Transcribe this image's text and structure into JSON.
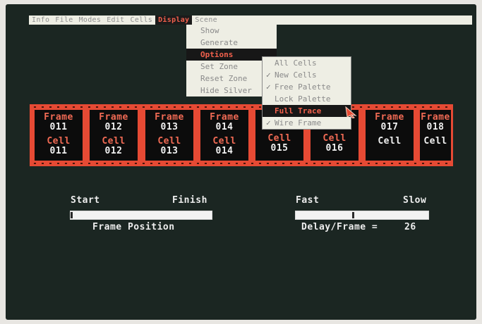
{
  "menubar": {
    "items": [
      "Info",
      "File",
      "Modes",
      "Edit",
      "Cells",
      "Display",
      "Scene"
    ],
    "active": "Display"
  },
  "display_menu": {
    "items": [
      "Show",
      "Generate",
      "Options",
      "Set Zone",
      "Reset Zone",
      "Hide Silver"
    ],
    "selected": "Options"
  },
  "options_menu": {
    "items": [
      {
        "label": "All Cells",
        "checked": false
      },
      {
        "label": "New Cells",
        "checked": true
      },
      {
        "label": "Free Palette",
        "checked": true
      },
      {
        "label": "Lock Palette",
        "checked": false
      },
      {
        "label": "Full Trace",
        "checked": false,
        "selected": true
      },
      {
        "label": "Wire Frame",
        "checked": true
      }
    ]
  },
  "filmstrip": {
    "frames": [
      {
        "frame_label": "Frame",
        "frame_num": "011",
        "cell_label": "Cell",
        "cell_num": "011"
      },
      {
        "frame_label": "Frame",
        "frame_num": "012",
        "cell_label": "Cell",
        "cell_num": "012"
      },
      {
        "frame_label": "Frame",
        "frame_num": "013",
        "cell_label": "Cell",
        "cell_num": "013"
      },
      {
        "frame_label": "Frame",
        "frame_num": "014",
        "cell_label": "Cell",
        "cell_num": "014"
      },
      {
        "frame_label": "",
        "frame_num": "",
        "cell_label": "Cell",
        "cell_num": "015"
      },
      {
        "frame_label": "",
        "frame_num": "",
        "cell_label": "Cell",
        "cell_num": "016"
      },
      {
        "frame_label": "Frame",
        "frame_num": "017",
        "cell_label": "Cell",
        "cell_num": ""
      },
      {
        "frame_label": "Frame",
        "frame_num": "018",
        "cell_label": "Cell",
        "cell_num": ""
      }
    ]
  },
  "frame_position": {
    "start_label": "Start",
    "finish_label": "Finish",
    "caption": "Frame Position",
    "value": 0.0
  },
  "speed": {
    "fast_label": "Fast",
    "slow_label": "Slow",
    "caption": "Delay/Frame =",
    "delay_value": "26",
    "value": 0.43
  },
  "colors": {
    "film": "#e64a34",
    "accent_text": "#f06a54",
    "screen_bg": "#1b2622"
  }
}
